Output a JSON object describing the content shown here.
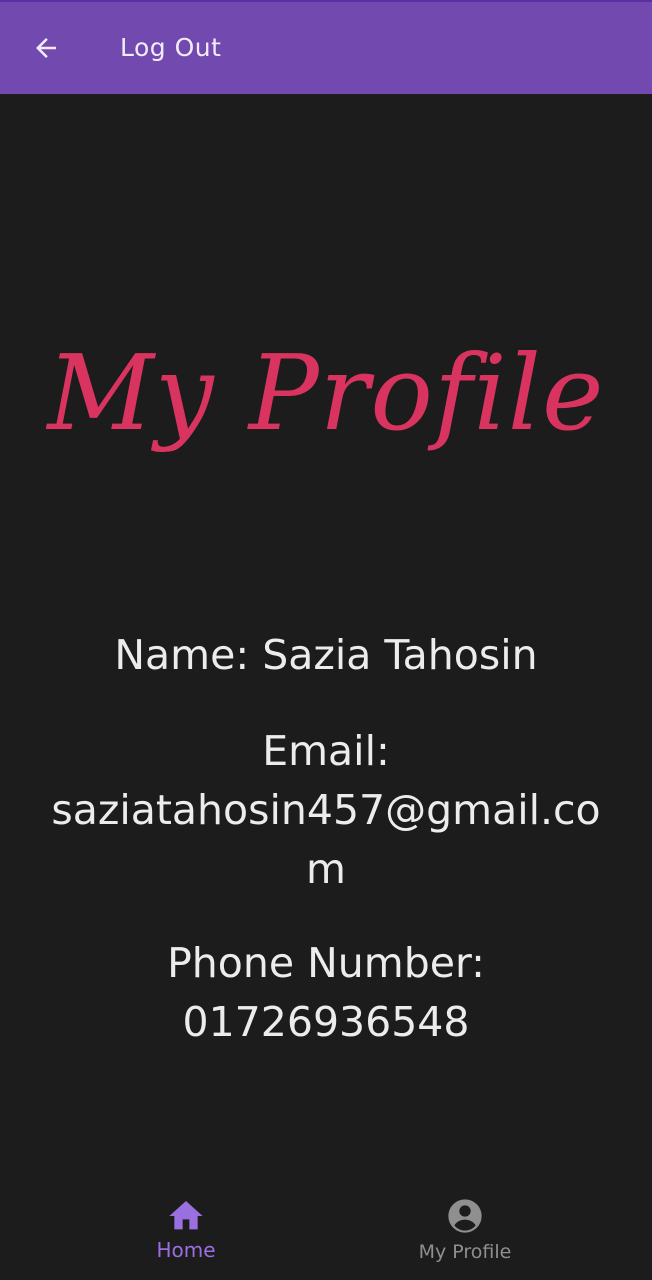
{
  "appbar": {
    "back_icon": "arrow-left-icon",
    "title": "Log Out",
    "background": "#7249ae"
  },
  "main": {
    "heading": "My Profile",
    "heading_color": "#d8345f",
    "name_line": "Name: Sazia Tahosin",
    "email_label": "Email:",
    "email_value": "saziatahosin457@gmail.com",
    "phone_label": "Phone Number:",
    "phone_value": "01726936548"
  },
  "bottom_nav": {
    "items": [
      {
        "label": "Home",
        "icon": "home-icon",
        "active": true,
        "color": "#9a6fe0"
      },
      {
        "label": "My Profile",
        "icon": "account-circle-icon",
        "active": false,
        "color": "#8f8f8f"
      }
    ]
  }
}
